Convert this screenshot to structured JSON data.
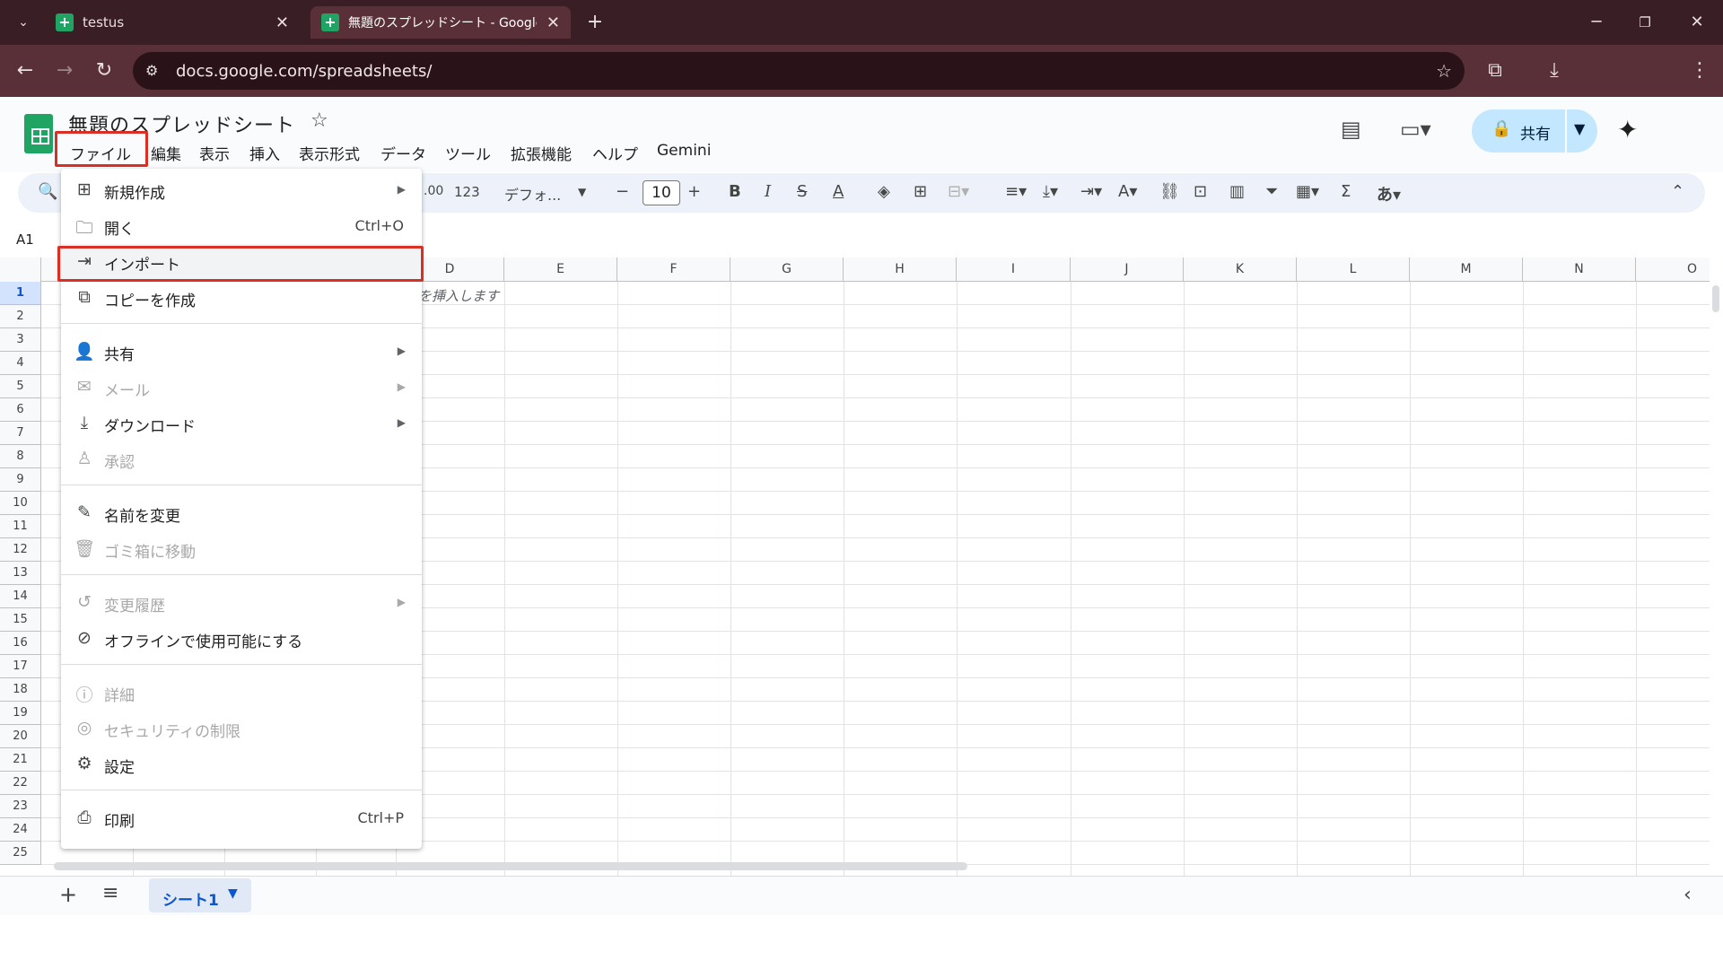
{
  "browser": {
    "tabs": [
      {
        "title": "testus"
      },
      {
        "title": "無題のスプレッドシート - Google ス"
      }
    ],
    "url": "docs.google.com/spreadsheets/"
  },
  "doc": {
    "title": "無題のスプレッドシート",
    "menu": [
      "ファイル",
      "編集",
      "表示",
      "挿入",
      "表示形式",
      "データ",
      "ツール",
      "拡張機能",
      "ヘルプ",
      "Gemini"
    ],
    "share_label": "共有"
  },
  "toolbar": {
    "number_format": "123",
    "font": "デフォ...",
    "font_size": "10"
  },
  "namebox": "A1",
  "grid": {
    "columns": [
      "D",
      "E",
      "F",
      "G",
      "H",
      "I",
      "J",
      "K",
      "L",
      "M",
      "N",
      "O"
    ],
    "rows": [
      "1",
      "2",
      "3",
      "4",
      "5",
      "6",
      "7",
      "8",
      "9",
      "10",
      "11",
      "12",
      "13",
      "14",
      "15",
      "16",
      "17",
      "18",
      "19",
      "20",
      "21",
      "22",
      "23",
      "24",
      "25"
    ],
    "cell_hint": "を挿入します"
  },
  "sheet_tab": "シート1",
  "file_menu": {
    "items": [
      {
        "label": "新規作成",
        "icon": "plus-box-icon",
        "submenu": true
      },
      {
        "label": "開く",
        "icon": "folder-icon",
        "shortcut": "Ctrl+O"
      },
      {
        "label": "インポート",
        "icon": "import-icon"
      },
      {
        "label": "コピーを作成",
        "icon": "copy-icon"
      },
      {
        "label": "共有",
        "icon": "person-add-icon",
        "submenu": true
      },
      {
        "label": "メール",
        "icon": "mail-icon",
        "submenu": true,
        "disabled": true
      },
      {
        "label": "ダウンロード",
        "icon": "download-icon",
        "submenu": true
      },
      {
        "label": "承認",
        "icon": "approval-icon",
        "disabled": true
      },
      {
        "label": "名前を変更",
        "icon": "pencil-icon"
      },
      {
        "label": "ゴミ箱に移動",
        "icon": "trash-icon",
        "disabled": true
      },
      {
        "label": "変更履歴",
        "icon": "history-icon",
        "submenu": true,
        "disabled": true
      },
      {
        "label": "オフラインで使用可能にする",
        "icon": "offline-check-icon"
      },
      {
        "label": "詳細",
        "icon": "info-icon",
        "disabled": true
      },
      {
        "label": "セキュリティの制限",
        "icon": "security-icon",
        "disabled": true
      },
      {
        "label": "設定",
        "icon": "gear-icon"
      },
      {
        "label": "印刷",
        "icon": "printer-icon",
        "shortcut": "Ctrl+P"
      }
    ]
  },
  "colors": {
    "accent": "#0b57d0",
    "highlight": "#d93025",
    "share_bg": "#c2e7ff"
  }
}
